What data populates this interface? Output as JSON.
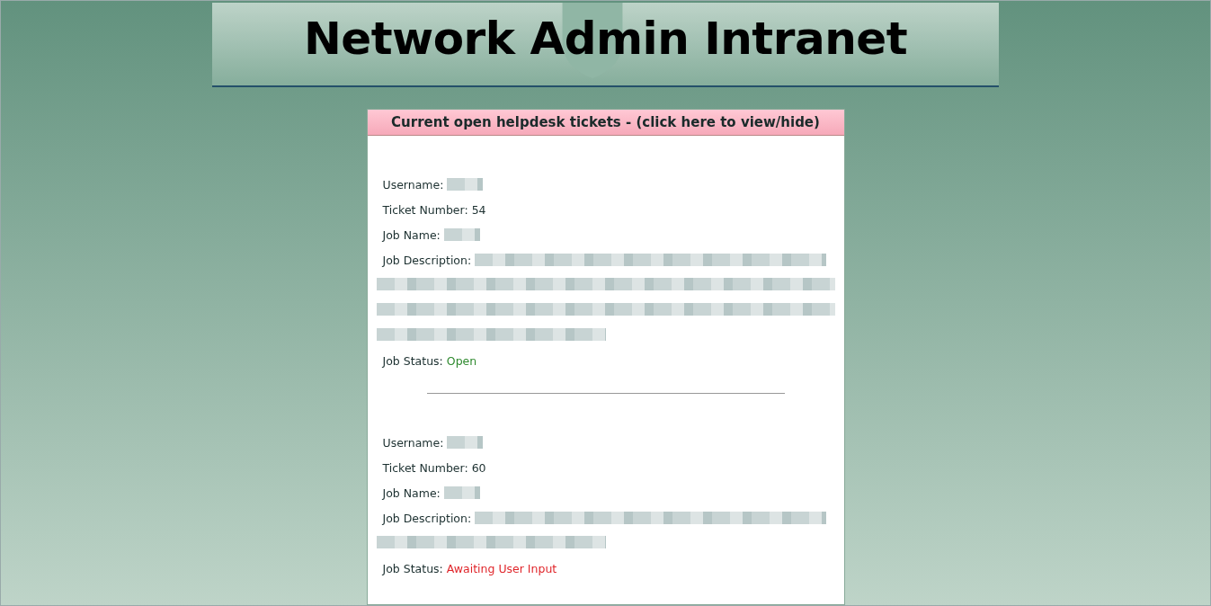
{
  "header": {
    "title": "Network Admin Intranet"
  },
  "tickets_panel": {
    "heading": "Current open helpdesk tickets - (click here to view/hide)",
    "tickets": [
      {
        "fields": [
          {
            "label": "Username:",
            "kind": "blurred"
          },
          {
            "label": "Ticket Number:",
            "kind": "text",
            "value": "54"
          },
          {
            "label": "Job Name:",
            "kind": "blurred"
          },
          {
            "label": "Job Description:",
            "kind": "blurred_paragraph",
            "lines": [
              {
                "kind": "full"
              },
              {
                "kind": "full"
              },
              {
                "kind": "full"
              },
              {
                "kind": "partial"
              }
            ]
          },
          {
            "label": "Job Status:",
            "kind": "status",
            "value": "Open",
            "color": "#2f8a2f"
          }
        ]
      },
      {
        "fields": [
          {
            "label": "Username:",
            "kind": "blurred"
          },
          {
            "label": "Ticket Number:",
            "kind": "text",
            "value": "60"
          },
          {
            "label": "Job Name:",
            "kind": "blurred"
          },
          {
            "label": "Job Description:",
            "kind": "blurred_paragraph",
            "lines": [
              {
                "kind": "full"
              },
              {
                "kind": "partial"
              }
            ]
          },
          {
            "label": "Job Status:",
            "kind": "status",
            "value": "Awaiting User Input",
            "color": "#e0262b"
          }
        ]
      }
    ]
  }
}
